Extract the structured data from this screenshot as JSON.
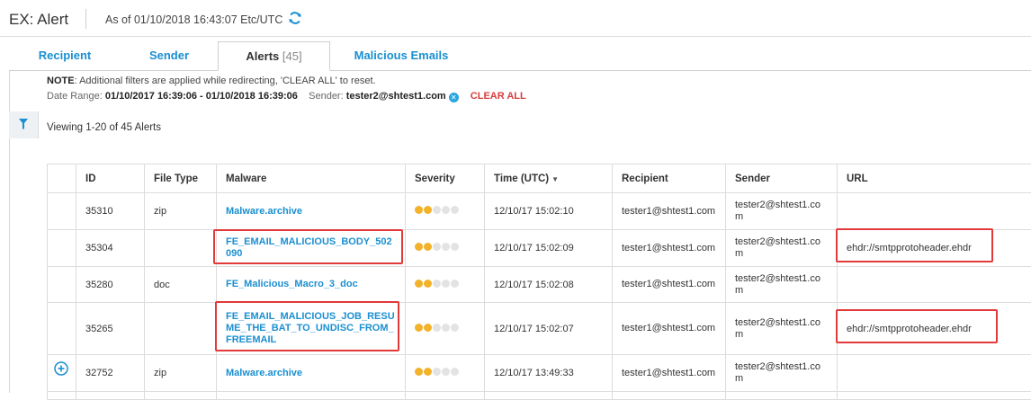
{
  "header": {
    "title": "EX: Alert",
    "as_of": "As of 01/10/2018 16:43:07 Etc/UTC"
  },
  "tabs": [
    {
      "label": "Recipient"
    },
    {
      "label": "Sender"
    },
    {
      "label": "Alerts",
      "count": "[45]",
      "active": true
    },
    {
      "label": "Malicious Emails"
    }
  ],
  "note": {
    "prefix": "NOTE",
    "text": ": Additional filters are applied while redirecting, 'CLEAR ALL' to reset."
  },
  "filters": {
    "date_label": "Date Range:",
    "date_value": "01/10/2017 16:39:06 - 01/10/2018 16:39:06",
    "sender_label": "Sender:",
    "sender_value": "tester2@shtest1.com",
    "clear_all": "CLEAR ALL"
  },
  "viewing": "Viewing 1-20 of 45 Alerts",
  "table": {
    "columns": [
      "ID",
      "File Type",
      "Malware",
      "Severity",
      "Time (UTC)",
      "Recipient",
      "Sender",
      "URL"
    ],
    "sorted_column": "Time (UTC)",
    "rows": [
      {
        "id": "35310",
        "file_type": "zip",
        "malware": "Malware.archive",
        "severity": 2,
        "time": "12/10/17 15:02:10",
        "recipient": "tester1@shtest1.com",
        "sender": "tester2@shtest1.com",
        "url": ""
      },
      {
        "id": "35304",
        "file_type": "",
        "malware": "FE_EMAIL_MALICIOUS_BODY_502090",
        "severity": 2,
        "time": "12/10/17 15:02:09",
        "recipient": "tester1@shtest1.com",
        "sender": "tester2@shtest1.com",
        "url": "ehdr://smtpprotoheader.ehdr"
      },
      {
        "id": "35280",
        "file_type": "doc",
        "malware": "FE_Malicious_Macro_3_doc",
        "severity": 2,
        "time": "12/10/17 15:02:08",
        "recipient": "tester1@shtest1.com",
        "sender": "tester2@shtest1.com",
        "url": ""
      },
      {
        "id": "35265",
        "file_type": "",
        "malware": "FE_EMAIL_MALICIOUS_JOB_RESUME_THE_BAT_TO_UNDISC_FROM_FREEMAIL",
        "severity": 2,
        "time": "12/10/17 15:02:07",
        "recipient": "tester1@shtest1.com",
        "sender": "tester2@shtest1.com",
        "url": "ehdr://smtpprotoheader.ehdr"
      },
      {
        "id": "32752",
        "file_type": "zip",
        "malware": "Malware.archive",
        "severity": 2,
        "time": "12/10/17 13:49:33",
        "recipient": "tester1@shtest1.com",
        "sender": "tester2@shtest1.com",
        "url": ""
      }
    ]
  },
  "colors": {
    "accent": "#1a8fd1",
    "severity_on": "#f2b22a",
    "severity_off": "#e3e3e3",
    "clear_all": "#d83c3c",
    "highlight": "#e23a3a"
  },
  "icons": {
    "refresh": "refresh-icon",
    "filter": "filter-icon",
    "sender_clear": "clear-filter-icon",
    "expand": "expand-row-icon",
    "sort": "sort-desc-icon"
  }
}
